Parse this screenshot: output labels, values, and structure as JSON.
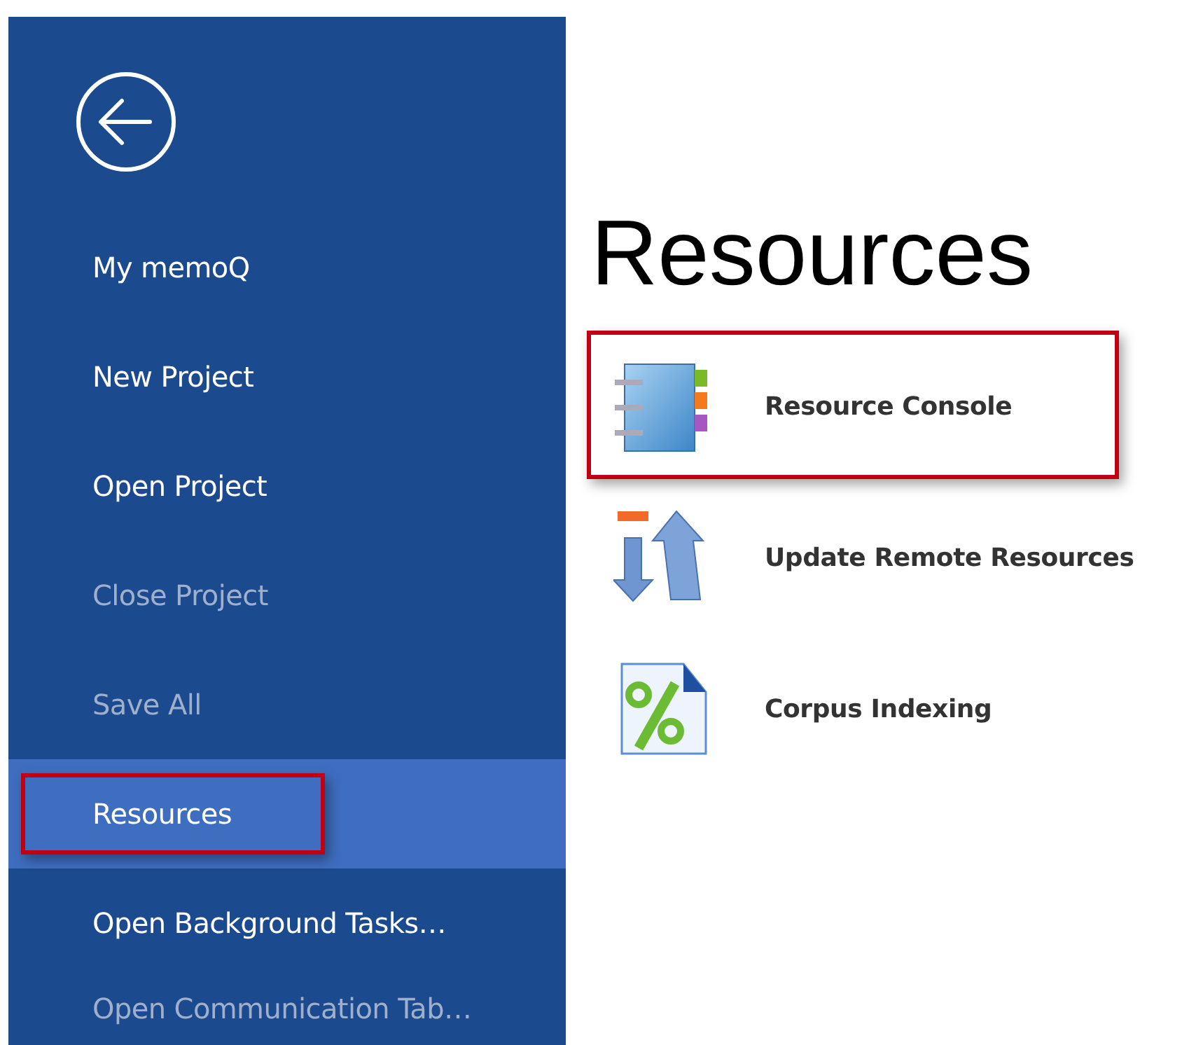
{
  "sidebar": {
    "items": [
      {
        "label": "My memoQ",
        "disabled": false,
        "selected": false,
        "highlighted": false
      },
      {
        "label": "New Project",
        "disabled": false,
        "selected": false,
        "highlighted": false
      },
      {
        "label": "Open Project",
        "disabled": false,
        "selected": false,
        "highlighted": false
      },
      {
        "label": "Close Project",
        "disabled": true,
        "selected": false,
        "highlighted": false
      },
      {
        "label": "Save All",
        "disabled": true,
        "selected": false,
        "highlighted": false
      },
      {
        "label": "Resources",
        "disabled": false,
        "selected": true,
        "highlighted": true
      },
      {
        "label": "Open Background Tasks…",
        "disabled": false,
        "selected": false,
        "highlighted": false
      },
      {
        "label": "Open Communication Tab…",
        "disabled": true,
        "selected": false,
        "highlighted": false
      }
    ]
  },
  "content": {
    "title": "Resources",
    "items": [
      {
        "kind": "console",
        "label": "Resource Console",
        "highlighted": true
      },
      {
        "kind": "update",
        "label": "Update Remote Resources",
        "highlighted": false
      },
      {
        "kind": "corpus",
        "label": "Corpus Indexing",
        "highlighted": false
      }
    ]
  }
}
